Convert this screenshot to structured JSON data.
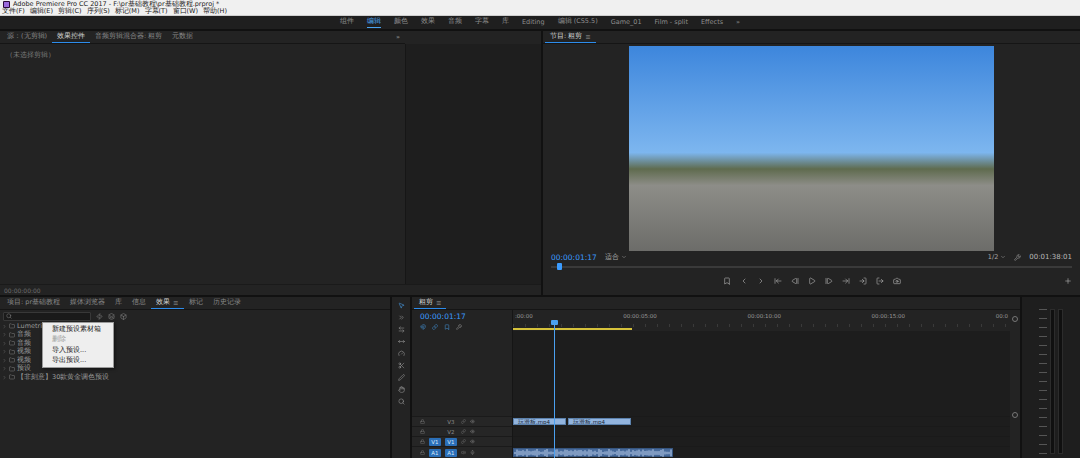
{
  "window": {
    "title": "Adobe Premiere Pro CC 2017 - F:\\pr基础教程\\pr基础教程.prproj *"
  },
  "menu": [
    "文件(F)",
    "编辑(E)",
    "剪辑(C)",
    "序列(S)",
    "标记(M)",
    "字幕(T)",
    "窗口(W)",
    "帮助(H)"
  ],
  "workspaces": [
    {
      "label": "组件",
      "selected": false
    },
    {
      "label": "编辑",
      "selected": true
    },
    {
      "label": "颜色",
      "selected": false
    },
    {
      "label": "效果",
      "selected": false
    },
    {
      "label": "音频",
      "selected": false
    },
    {
      "label": "字幕",
      "selected": false
    },
    {
      "label": "库",
      "selected": false
    },
    {
      "label": "Editing",
      "selected": false
    },
    {
      "label": "编辑 (CS5.5)",
      "selected": false
    },
    {
      "label": "Game_01",
      "selected": false
    },
    {
      "label": "Film - split",
      "selected": false
    },
    {
      "label": "Effects",
      "selected": false
    }
  ],
  "workspace_more": "»",
  "source": {
    "tabs": [
      {
        "label": "源：(无剪辑)",
        "selected": false
      },
      {
        "label": "效果控件",
        "selected": true
      },
      {
        "label": "音频剪辑混合器: 粗剪",
        "selected": false
      },
      {
        "label": "元数据",
        "selected": false
      }
    ],
    "more": "»",
    "empty_message": "（未选择剪辑）",
    "timecode": "00:00:00:00"
  },
  "program": {
    "tab": {
      "label": "节目: 粗剪",
      "selected": true,
      "menu": "≡"
    },
    "timecode": "00:00:01:17",
    "fit": "适合",
    "resolution": "1/2",
    "duration": "00:01:38:01",
    "level": 0.015
  },
  "project": {
    "tabs": [
      {
        "label": "项目: pr基础教程",
        "selected": false
      },
      {
        "label": "媒体浏览器",
        "selected": false
      },
      {
        "label": "库",
        "selected": false
      },
      {
        "label": "信息",
        "selected": false
      },
      {
        "label": "效果",
        "selected": true,
        "menu": "≡"
      },
      {
        "label": "标记",
        "selected": false
      },
      {
        "label": "历史记录",
        "selected": false
      }
    ],
    "folders": [
      {
        "label": "Lumetri",
        "expanded": false
      },
      {
        "label": "音频",
        "expanded": false
      },
      {
        "label": "音频",
        "expanded": false
      },
      {
        "label": "视频",
        "expanded": false
      },
      {
        "label": "视频",
        "expanded": false
      },
      {
        "label": "预设",
        "expanded": false
      },
      {
        "label": "【非刻意】30款黄金调色预设",
        "expanded": false
      }
    ],
    "context_menu": [
      {
        "label": "新建预设素材箱",
        "disabled": false
      },
      {
        "label": "删除",
        "disabled": true
      },
      {
        "label": "导入预设...",
        "disabled": false
      },
      {
        "label": "导出预设...",
        "disabled": false
      }
    ]
  },
  "timeline": {
    "tab": {
      "label": "粗剪",
      "selected": true,
      "menu": "≡"
    },
    "timecode": "00:00:01:17",
    "ruler": [
      ":00:00",
      "00:00:05:00",
      "00:00:10:00",
      "00:00:15:00",
      "00:0"
    ],
    "playhead": 0.083,
    "work_area": 0.24,
    "tracks": [
      {
        "name": "V3",
        "kind": "video",
        "targeted": false,
        "clips": [
          {
            "label": "玩滑板.mp4"
          },
          {
            "label": "玩滑板.mp4"
          }
        ]
      },
      {
        "name": "V2",
        "kind": "video",
        "targeted": false,
        "clips": []
      },
      {
        "name": "V1",
        "kind": "video",
        "patch": "V1",
        "targeted": true,
        "clips": []
      },
      {
        "name": "A1",
        "kind": "audio",
        "patch": "A1",
        "targeted": true,
        "clips": []
      }
    ]
  }
}
